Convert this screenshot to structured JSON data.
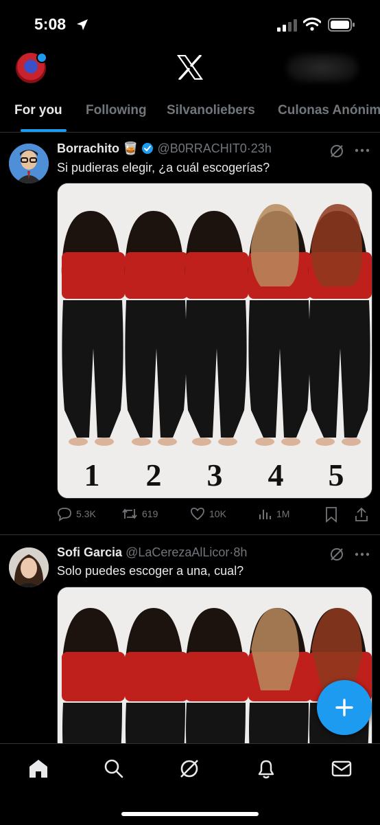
{
  "status_bar": {
    "time": "5:08"
  },
  "header": {
    "logo": "x-logo",
    "tabs": [
      {
        "label": "For you",
        "active": true
      },
      {
        "label": "Following",
        "active": false
      },
      {
        "label": "Silvanoliebers",
        "active": false
      },
      {
        "label": "Culonas Anónim",
        "active": false
      }
    ]
  },
  "tweets": [
    {
      "name": "Borrachito",
      "emoji": "🥃",
      "verified": true,
      "handle": "@B0RRACHIT0",
      "time": "23h",
      "text": "Si pudieras elegir, ¿a cuál escogerías?",
      "image_labels": [
        "1",
        "2",
        "3",
        "4",
        "5"
      ],
      "stats": {
        "replies": "5.3K",
        "reposts": "619",
        "likes": "10K",
        "views": "1M"
      }
    },
    {
      "name": "Sofi Garcia",
      "handle": "@LaCerezaAlLicor",
      "time": "8h",
      "text": "Solo puedes escoger a una, cual?"
    }
  ],
  "colors": {
    "accent": "#1d9bf0",
    "muted": "#71767b",
    "background": "#000000",
    "shirt": "#c0201c",
    "jeans": "#141414"
  },
  "bottom_nav": [
    "home-icon",
    "search-icon",
    "grok-icon",
    "notifications-icon",
    "messages-icon"
  ]
}
